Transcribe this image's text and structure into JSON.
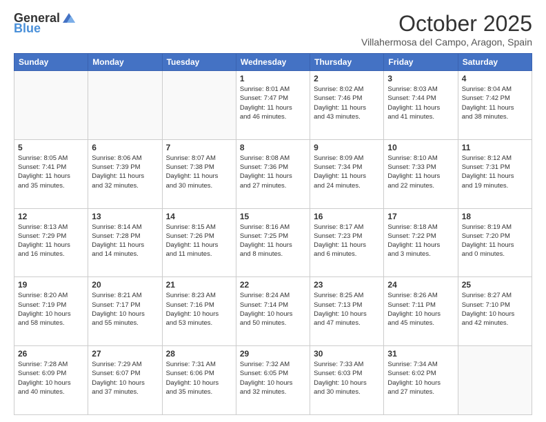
{
  "header": {
    "logo_general": "General",
    "logo_blue": "Blue",
    "month": "October 2025",
    "location": "Villahermosa del Campo, Aragon, Spain"
  },
  "weekdays": [
    "Sunday",
    "Monday",
    "Tuesday",
    "Wednesday",
    "Thursday",
    "Friday",
    "Saturday"
  ],
  "weeks": [
    [
      {
        "day": "",
        "info": ""
      },
      {
        "day": "",
        "info": ""
      },
      {
        "day": "",
        "info": ""
      },
      {
        "day": "1",
        "info": "Sunrise: 8:01 AM\nSunset: 7:47 PM\nDaylight: 11 hours\nand 46 minutes."
      },
      {
        "day": "2",
        "info": "Sunrise: 8:02 AM\nSunset: 7:46 PM\nDaylight: 11 hours\nand 43 minutes."
      },
      {
        "day": "3",
        "info": "Sunrise: 8:03 AM\nSunset: 7:44 PM\nDaylight: 11 hours\nand 41 minutes."
      },
      {
        "day": "4",
        "info": "Sunrise: 8:04 AM\nSunset: 7:42 PM\nDaylight: 11 hours\nand 38 minutes."
      }
    ],
    [
      {
        "day": "5",
        "info": "Sunrise: 8:05 AM\nSunset: 7:41 PM\nDaylight: 11 hours\nand 35 minutes."
      },
      {
        "day": "6",
        "info": "Sunrise: 8:06 AM\nSunset: 7:39 PM\nDaylight: 11 hours\nand 32 minutes."
      },
      {
        "day": "7",
        "info": "Sunrise: 8:07 AM\nSunset: 7:38 PM\nDaylight: 11 hours\nand 30 minutes."
      },
      {
        "day": "8",
        "info": "Sunrise: 8:08 AM\nSunset: 7:36 PM\nDaylight: 11 hours\nand 27 minutes."
      },
      {
        "day": "9",
        "info": "Sunrise: 8:09 AM\nSunset: 7:34 PM\nDaylight: 11 hours\nand 24 minutes."
      },
      {
        "day": "10",
        "info": "Sunrise: 8:10 AM\nSunset: 7:33 PM\nDaylight: 11 hours\nand 22 minutes."
      },
      {
        "day": "11",
        "info": "Sunrise: 8:12 AM\nSunset: 7:31 PM\nDaylight: 11 hours\nand 19 minutes."
      }
    ],
    [
      {
        "day": "12",
        "info": "Sunrise: 8:13 AM\nSunset: 7:29 PM\nDaylight: 11 hours\nand 16 minutes."
      },
      {
        "day": "13",
        "info": "Sunrise: 8:14 AM\nSunset: 7:28 PM\nDaylight: 11 hours\nand 14 minutes."
      },
      {
        "day": "14",
        "info": "Sunrise: 8:15 AM\nSunset: 7:26 PM\nDaylight: 11 hours\nand 11 minutes."
      },
      {
        "day": "15",
        "info": "Sunrise: 8:16 AM\nSunset: 7:25 PM\nDaylight: 11 hours\nand 8 minutes."
      },
      {
        "day": "16",
        "info": "Sunrise: 8:17 AM\nSunset: 7:23 PM\nDaylight: 11 hours\nand 6 minutes."
      },
      {
        "day": "17",
        "info": "Sunrise: 8:18 AM\nSunset: 7:22 PM\nDaylight: 11 hours\nand 3 minutes."
      },
      {
        "day": "18",
        "info": "Sunrise: 8:19 AM\nSunset: 7:20 PM\nDaylight: 11 hours\nand 0 minutes."
      }
    ],
    [
      {
        "day": "19",
        "info": "Sunrise: 8:20 AM\nSunset: 7:19 PM\nDaylight: 10 hours\nand 58 minutes."
      },
      {
        "day": "20",
        "info": "Sunrise: 8:21 AM\nSunset: 7:17 PM\nDaylight: 10 hours\nand 55 minutes."
      },
      {
        "day": "21",
        "info": "Sunrise: 8:23 AM\nSunset: 7:16 PM\nDaylight: 10 hours\nand 53 minutes."
      },
      {
        "day": "22",
        "info": "Sunrise: 8:24 AM\nSunset: 7:14 PM\nDaylight: 10 hours\nand 50 minutes."
      },
      {
        "day": "23",
        "info": "Sunrise: 8:25 AM\nSunset: 7:13 PM\nDaylight: 10 hours\nand 47 minutes."
      },
      {
        "day": "24",
        "info": "Sunrise: 8:26 AM\nSunset: 7:11 PM\nDaylight: 10 hours\nand 45 minutes."
      },
      {
        "day": "25",
        "info": "Sunrise: 8:27 AM\nSunset: 7:10 PM\nDaylight: 10 hours\nand 42 minutes."
      }
    ],
    [
      {
        "day": "26",
        "info": "Sunrise: 7:28 AM\nSunset: 6:09 PM\nDaylight: 10 hours\nand 40 minutes."
      },
      {
        "day": "27",
        "info": "Sunrise: 7:29 AM\nSunset: 6:07 PM\nDaylight: 10 hours\nand 37 minutes."
      },
      {
        "day": "28",
        "info": "Sunrise: 7:31 AM\nSunset: 6:06 PM\nDaylight: 10 hours\nand 35 minutes."
      },
      {
        "day": "29",
        "info": "Sunrise: 7:32 AM\nSunset: 6:05 PM\nDaylight: 10 hours\nand 32 minutes."
      },
      {
        "day": "30",
        "info": "Sunrise: 7:33 AM\nSunset: 6:03 PM\nDaylight: 10 hours\nand 30 minutes."
      },
      {
        "day": "31",
        "info": "Sunrise: 7:34 AM\nSunset: 6:02 PM\nDaylight: 10 hours\nand 27 minutes."
      },
      {
        "day": "",
        "info": ""
      }
    ]
  ]
}
